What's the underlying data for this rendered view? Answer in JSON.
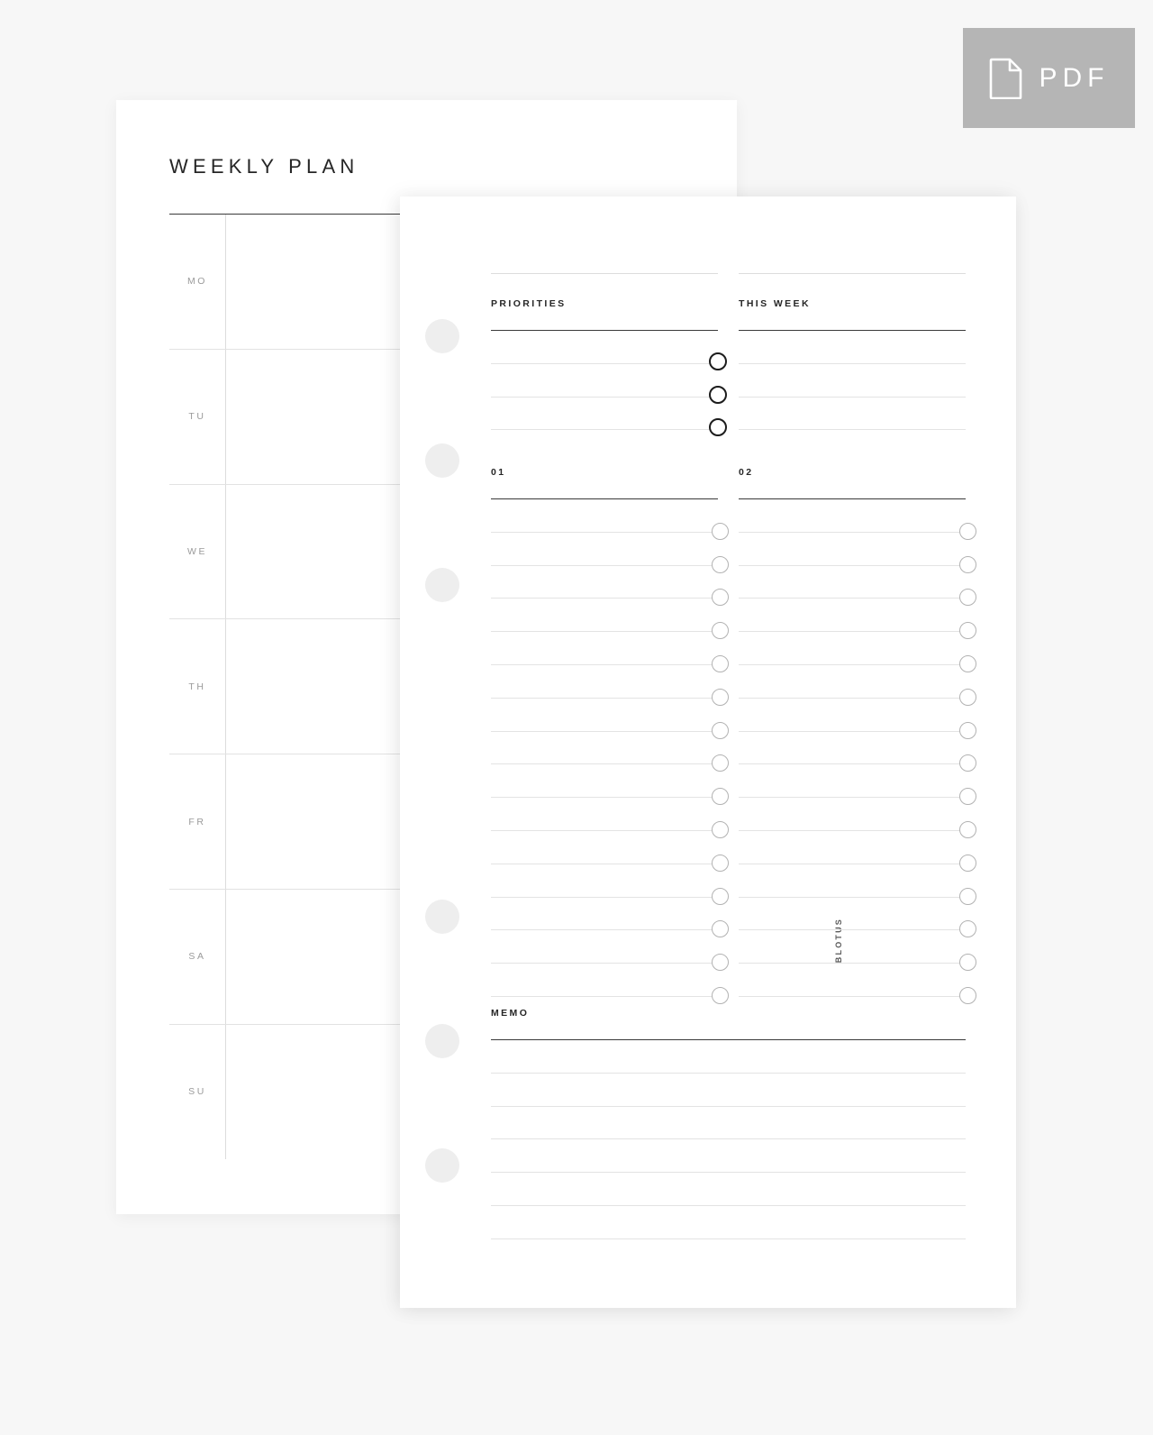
{
  "badge": {
    "label": "PDF",
    "icon": "pdf-document-icon",
    "bg_color": "#b5b5b5",
    "text_color": "#ffffff"
  },
  "background_color": "#f7f7f7",
  "page_color": "#ffffff",
  "left_page": {
    "title": "WEEKLY PLAN",
    "days": [
      {
        "label": "MO"
      },
      {
        "label": "TU"
      },
      {
        "label": "WE"
      },
      {
        "label": "TH"
      },
      {
        "label": "FR"
      },
      {
        "label": "SA"
      },
      {
        "label": "SU"
      }
    ]
  },
  "right_page": {
    "brand": "BLOTUS",
    "sections": {
      "priorities": {
        "heading": "PRIORITIES",
        "row_count": 3
      },
      "this_week": {
        "heading": "THIS WEEK",
        "row_count": 3
      },
      "list_01": {
        "heading": "01",
        "row_count": 15
      },
      "list_02": {
        "heading": "02",
        "row_count": 15
      },
      "memo": {
        "heading": "MEMO",
        "row_count": 6
      }
    }
  },
  "colors": {
    "title_text": "#262626",
    "day_label": "#9a9a9a",
    "rule_light": "#e3e3e3",
    "rule_dark": "#3a3a3a",
    "bubble_light": "#b2b2b2",
    "bubble_dark": "#1c1c1c",
    "hole": "#eeeeee"
  }
}
